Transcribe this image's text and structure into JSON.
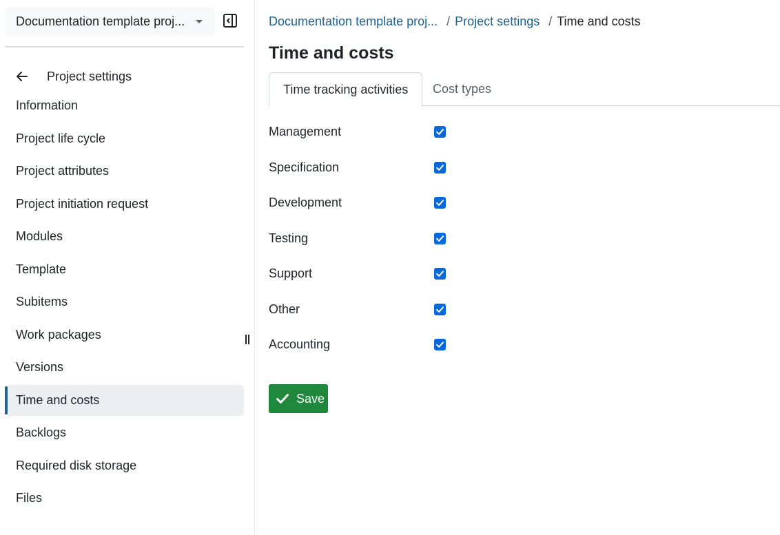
{
  "sidebar": {
    "project_name": "Documentation template proj...",
    "back_label": "Project settings",
    "items": [
      {
        "label": "Information"
      },
      {
        "label": "Project life cycle"
      },
      {
        "label": "Project attributes"
      },
      {
        "label": "Project initiation request"
      },
      {
        "label": "Modules"
      },
      {
        "label": "Template"
      },
      {
        "label": "Subitems"
      },
      {
        "label": "Work packages"
      },
      {
        "label": "Versions"
      },
      {
        "label": "Time and costs",
        "active": true
      },
      {
        "label": "Backlogs"
      },
      {
        "label": "Required disk storage"
      },
      {
        "label": "Files"
      }
    ]
  },
  "breadcrumb": {
    "project": "Documentation template proj...",
    "settings": "Project settings",
    "current": "Time and costs",
    "separator": "/"
  },
  "main": {
    "title": "Time and costs",
    "tabs": [
      {
        "label": "Time tracking activities",
        "selected": true
      },
      {
        "label": "Cost types",
        "selected": false
      }
    ],
    "activities": [
      {
        "label": "Management",
        "checked": true
      },
      {
        "label": "Specification",
        "checked": true
      },
      {
        "label": "Development",
        "checked": true
      },
      {
        "label": "Testing",
        "checked": true
      },
      {
        "label": "Support",
        "checked": true
      },
      {
        "label": "Other",
        "checked": true
      },
      {
        "label": "Accounting",
        "checked": true
      }
    ],
    "save_label": "Save"
  },
  "colors": {
    "accent_link": "#1f6392",
    "checkbox": "#0969da",
    "save_button": "#1f883d",
    "active_item_bg": "#eceef1"
  },
  "icons": {
    "collapse": "sidebar-collapse-icon",
    "back": "arrow-left-icon",
    "dropdown": "caret-down-icon",
    "save": "check-icon",
    "resize": "resize-handle-icon"
  }
}
